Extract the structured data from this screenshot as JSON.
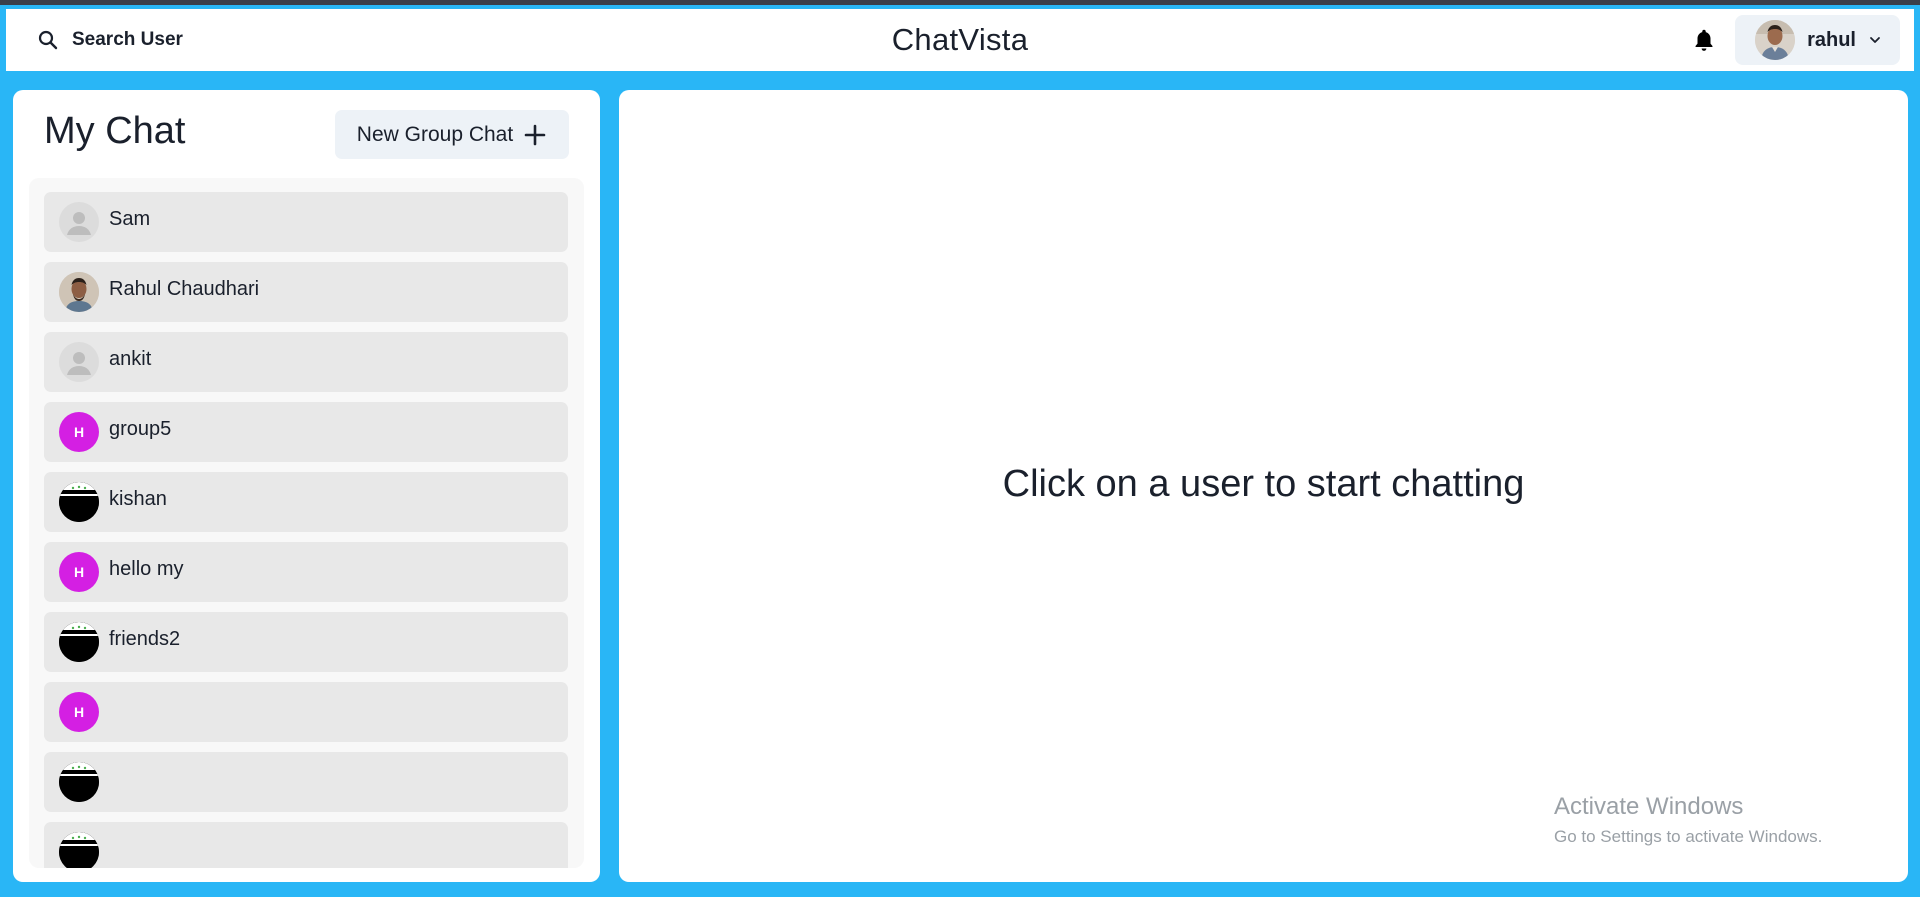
{
  "header": {
    "search_label": "Search User",
    "app_title": "ChatVista",
    "user_name": "rahul"
  },
  "sidebar": {
    "title": "My Chat",
    "new_group_label": "New Group Chat",
    "chats": [
      {
        "name": "Sam",
        "avatar": "default-user-icon"
      },
      {
        "name": "Rahul Chaudhari",
        "avatar": "photo"
      },
      {
        "name": "ankit",
        "avatar": "default-user-icon"
      },
      {
        "name": "group5",
        "avatar": "H"
      },
      {
        "name": "kishan",
        "avatar": "image"
      },
      {
        "name": "hello my",
        "avatar": "H"
      },
      {
        "name": "friends2",
        "avatar": "image"
      },
      {
        "name": "",
        "avatar": "H"
      },
      {
        "name": "",
        "avatar": "image"
      },
      {
        "name": "",
        "avatar": "image"
      }
    ]
  },
  "main": {
    "empty_message": "Click on a user to start chatting"
  },
  "watermark": {
    "title": "Activate Windows",
    "subtitle": "Go to Settings to activate Windows."
  },
  "colors": {
    "background": "#29b6f6",
    "group_avatar": "#d41fe3",
    "chat_item": "#e8e8e8",
    "button": "#edf2f7"
  }
}
